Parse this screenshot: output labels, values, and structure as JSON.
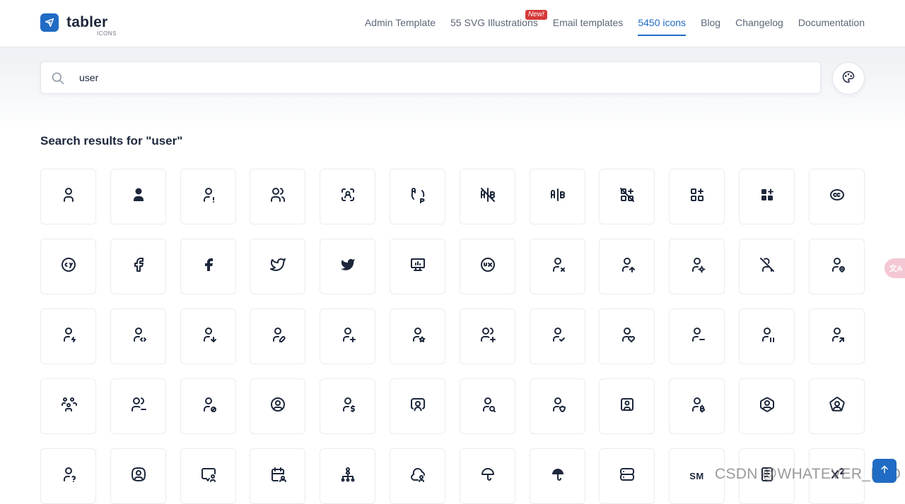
{
  "header": {
    "logo_name": "tabler",
    "logo_sub": "ICONS",
    "nav": [
      {
        "label": "Admin Template"
      },
      {
        "label": "55 SVG Illustrations",
        "badge": "New!"
      },
      {
        "label": "Email templates"
      },
      {
        "label": "5450 icons",
        "active": true
      },
      {
        "label": "Blog"
      },
      {
        "label": "Changelog"
      },
      {
        "label": "Documentation"
      }
    ]
  },
  "search": {
    "value": "user"
  },
  "results": {
    "heading": "Search results for \"user\"",
    "icons": [
      [
        "user-icon",
        "user-filled-icon",
        "user-exclamation-icon",
        "users-icon",
        "user-scan-icon",
        "a-b-2-icon",
        "a-b-off-icon",
        "a-b-icon",
        "apps-off-icon",
        "apps-icon",
        "apps-filled-icon",
        "brand-creative-commons-icon"
      ],
      [
        "brand-creative-commons-by-icon",
        "brand-facebook-icon",
        "brand-facebook-filled-icon",
        "brand-twitter-icon",
        "brand-twitter-filled-icon",
        "device-desktop-analytics-icon",
        "ux-circle-icon",
        "user-x-icon",
        "user-up-icon",
        "user-cog-icon",
        "user-off-icon",
        "user-pin-icon"
      ],
      [
        "user-bolt-icon",
        "user-code-icon",
        "user-down-icon",
        "user-edit-icon",
        "user-plus-icon",
        "user-star-icon",
        "users-plus-icon",
        "user-check-icon",
        "user-heart-icon",
        "user-minus-icon",
        "user-pause-icon",
        "user-share-icon"
      ],
      [
        "users-group-icon",
        "users-minus-icon",
        "user-cancel-icon",
        "user-circle-icon",
        "user-dollar-icon",
        "user-screen-icon",
        "user-search-icon",
        "user-shield-icon",
        "user-square-icon",
        "user-bitcoin-icon",
        "user-hexagon-icon",
        "user-pentagon-icon"
      ],
      [
        "user-question-icon",
        "user-square-rounded-icon",
        "message-user-icon",
        "calendar-user-icon",
        "hierarchy-users-icon",
        "bubble-user-icon",
        "umbrella-icon",
        "umbrella-filled-icon",
        "server-icon",
        "sm-icon",
        "notes-icon",
        "superscript-icon"
      ]
    ],
    "text_icons": {
      "sm-icon": "SM"
    }
  },
  "watermark": "CSDN @WHATEVER_LEO",
  "translate_label": "文A",
  "colors": {
    "accent": "#206bc4",
    "text": "#1d273b",
    "badge": "#d63939"
  }
}
